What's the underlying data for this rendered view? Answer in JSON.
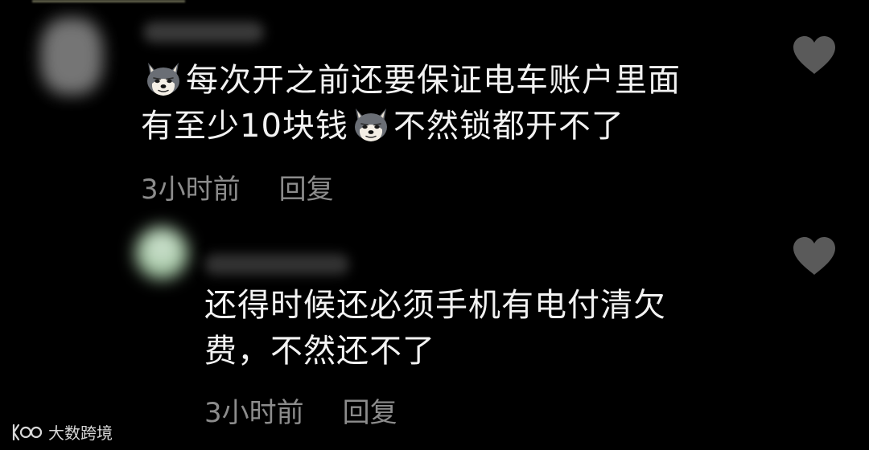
{
  "comments": [
    {
      "line1": "每次开之前还要保证电车账户里面",
      "line2_before": "有至少10块钱",
      "line2_after": "不然锁都开不了",
      "emoji_icon": "husky-dog-emoji-icon",
      "time": "3小时前",
      "reply": "回复",
      "like_icon": "heart-icon"
    },
    {
      "line1": "还得时候还必须手机有电付清欠",
      "line2": "费，不然还不了",
      "time": "3小时前",
      "reply": "回复",
      "like_icon": "heart-icon"
    }
  ],
  "watermark": {
    "logo_icon": "dashu-kuajing-logo-icon",
    "text": "大数跨境"
  },
  "colors": {
    "background": "#000000",
    "text": "#f2f2f2",
    "meta": "#8c8c8c",
    "heart": "#5a5a5a"
  }
}
